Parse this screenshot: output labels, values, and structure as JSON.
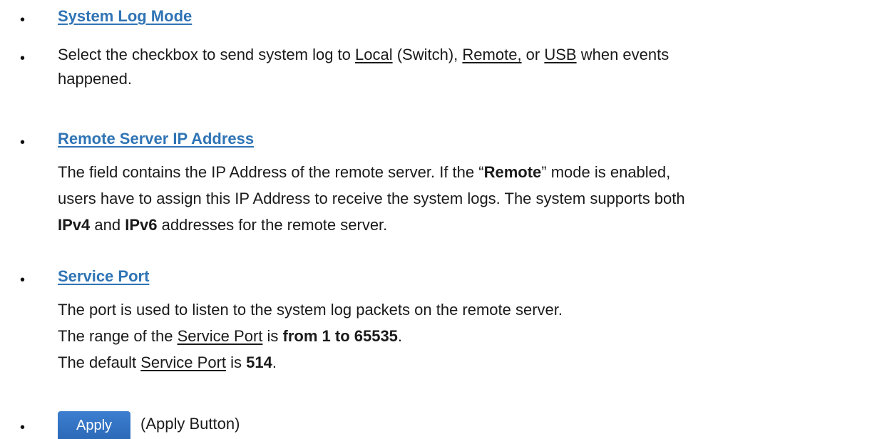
{
  "sections": {
    "system_log_mode": {
      "heading": "System Log Mode",
      "line1_before_local": "Select the checkbox to send system log to ",
      "local_link": "Local",
      "line1_between": " (Switch), ",
      "remote_link": "Remote,",
      "line1_or": " or ",
      "usb_link": "USB",
      "line1_after": " when events",
      "line2": "happened."
    },
    "remote_server_ip": {
      "heading": "Remote Server IP Address",
      "line1_before": "The field contains the IP Address of the remote server. If the “",
      "remote_bold": "Remote",
      "line1_after": "” mode is enabled,",
      "line2": "users have to assign this IP Address to receive the system logs. The system supports both",
      "ipv4": "IPv4",
      "and": " and ",
      "ipv6": "IPv6",
      "line3_after": " addresses for the remote server."
    },
    "service_port": {
      "heading": "Service Port",
      "line1": "The port is used to listen to the system log packets on the remote server.",
      "line2_before": "The range of the ",
      "line2_link": "Service Port",
      "line2_is": " is ",
      "line2_range": "from 1 to 65535",
      "line2_end": ".",
      "line3_before": "The default ",
      "line3_link": "Service Port",
      "line3_is": " is ",
      "line3_value": "514",
      "line3_end": "."
    },
    "apply": {
      "button_label": "Apply",
      "caption": "(Apply Button)"
    }
  }
}
